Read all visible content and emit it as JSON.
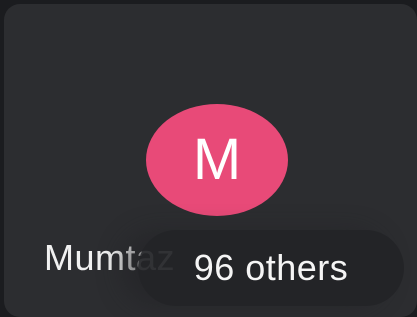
{
  "participant": {
    "initial": "M",
    "name": "Mumtaz",
    "avatar_color": "#e84a78"
  },
  "overflow": {
    "label": "96 others"
  }
}
